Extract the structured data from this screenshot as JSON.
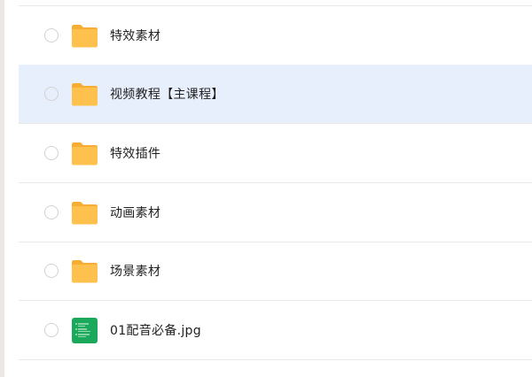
{
  "file_list": {
    "items": [
      {
        "name": "特效素材",
        "icon": "folder-icon",
        "selected": false
      },
      {
        "name": "视频教程【主课程】",
        "icon": "folder-icon",
        "selected": true
      },
      {
        "name": "特效插件",
        "icon": "folder-icon",
        "selected": false
      },
      {
        "name": "动画素材",
        "icon": "folder-icon",
        "selected": false
      },
      {
        "name": "场景素材",
        "icon": "folder-icon",
        "selected": false
      },
      {
        "name": "01配音必备.jpg",
        "icon": "image-file-icon",
        "selected": false
      }
    ]
  },
  "colors": {
    "folder": "#ffc14d",
    "folder_tab": "#f7ad32",
    "selected_row": "#e8effc",
    "image_thumb": "#1aa85a"
  }
}
